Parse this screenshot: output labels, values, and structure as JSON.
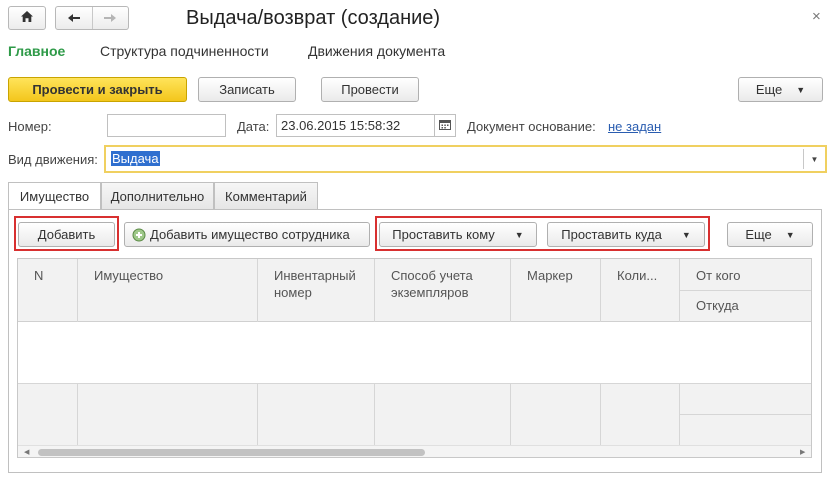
{
  "window": {
    "title": "Выдача/возврат (создание)",
    "close_glyph": "×"
  },
  "icons": {
    "home": "home-icon",
    "back": "arrow-left-icon",
    "forward": "arrow-right-icon",
    "calendar": "calendar-icon",
    "add_person": "add-employee-property-icon"
  },
  "nav_tabs": [
    {
      "label": "Главное",
      "active": true
    },
    {
      "label": "Структура подчиненности",
      "active": false
    },
    {
      "label": "Движения документа",
      "active": false
    }
  ],
  "toolbar": {
    "post_close": "Провести и закрыть",
    "save": "Записать",
    "post": "Провести",
    "more": "Еще"
  },
  "form": {
    "number_label": "Номер:",
    "number_value": "",
    "date_label": "Дата:",
    "date_value": "23.06.2015 15:58:32",
    "basis_label": "Документ основание:",
    "basis_link": "не задан",
    "movement_label": "Вид движения:",
    "movement_value": "Выдача"
  },
  "page_tabs": [
    {
      "label": "Имущество",
      "active": true
    },
    {
      "label": "Дополнительно",
      "active": false
    },
    {
      "label": "Комментарий",
      "active": false
    }
  ],
  "table_toolbar": {
    "add": "Добавить",
    "add_employee_property": "Добавить имущество сотрудника",
    "set_whom": "Проставить кому",
    "set_where": "Проставить куда",
    "more": "Еще"
  },
  "table": {
    "columns": [
      "N",
      "Имущество",
      "Инвентарный номер",
      "Способ учета экземпляров",
      "Маркер",
      "Коли...",
      "От кого"
    ],
    "subcolumn": "Откуда",
    "rows": []
  },
  "colors": {
    "accent_green": "#2e9a48",
    "primary_yellow": "#f3c61c",
    "highlight_red": "#d83030",
    "link_blue": "#2a5db0",
    "selection_blue": "#2f6fcf"
  }
}
